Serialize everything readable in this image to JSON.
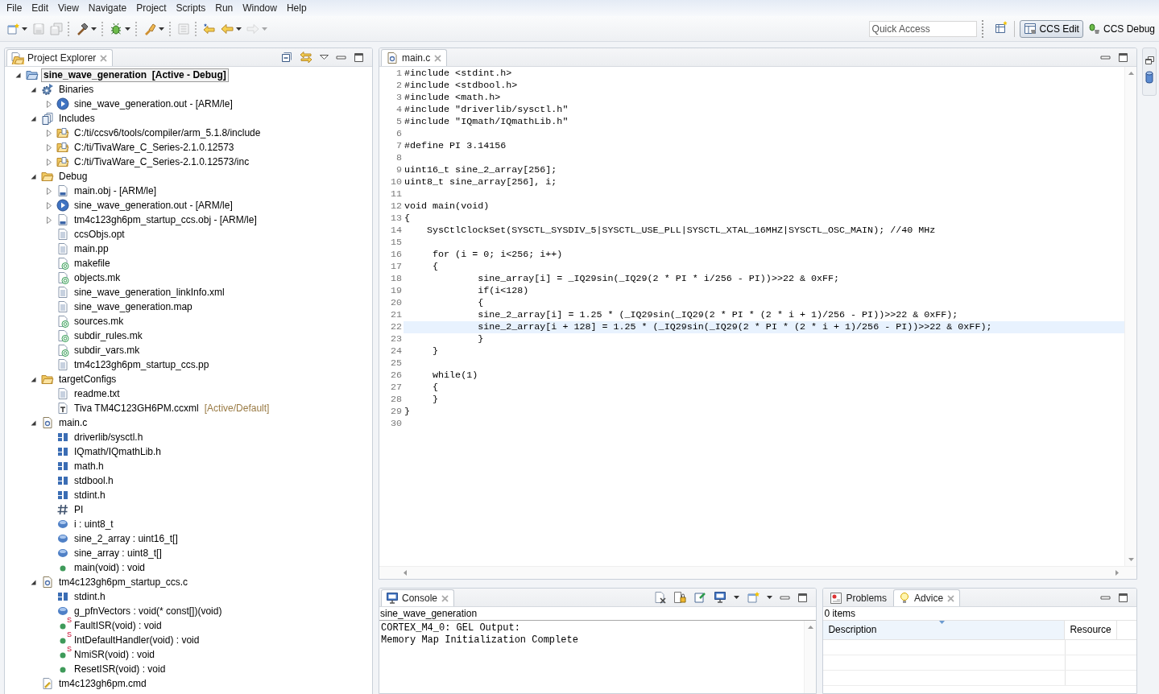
{
  "menu": [
    "File",
    "Edit",
    "View",
    "Navigate",
    "Project",
    "Scripts",
    "Run",
    "Window",
    "Help"
  ],
  "toolbar": {
    "buttons": [
      {
        "kind": "new",
        "disabled": false,
        "dropdown": true
      },
      {
        "kind": "save",
        "disabled": true,
        "dropdown": false
      },
      {
        "kind": "save-all",
        "disabled": true,
        "dropdown": false
      },
      {
        "kind": "separator"
      },
      {
        "kind": "build",
        "disabled": false,
        "dropdown": true
      },
      {
        "kind": "separator"
      },
      {
        "kind": "debug",
        "disabled": false,
        "dropdown": true
      },
      {
        "kind": "separator"
      },
      {
        "kind": "flash",
        "disabled": false,
        "dropdown": true
      },
      {
        "kind": "separator"
      },
      {
        "kind": "terminal",
        "disabled": true,
        "dropdown": false
      },
      {
        "kind": "separator"
      },
      {
        "kind": "last-edit",
        "disabled": false,
        "dropdown": false
      },
      {
        "kind": "back",
        "disabled": false,
        "dropdown": true
      },
      {
        "kind": "forward",
        "disabled": true,
        "dropdown": true
      }
    ],
    "quick_access": {
      "placeholder": "Quick Access"
    },
    "perspectives": [
      {
        "label": "CCS Edit",
        "kind": "edit",
        "selected": true
      },
      {
        "label": "CCS Debug",
        "kind": "debug",
        "selected": false
      }
    ]
  },
  "project_explorer": {
    "tabs": [
      {
        "label": "Project Explorer",
        "selected": true
      }
    ],
    "items": [
      {
        "label": "sine_wave_generation  [Active - Debug]",
        "kind": "project",
        "expanded": true,
        "selected": true,
        "children": [
          {
            "label": "Binaries",
            "kind": "binaries",
            "expanded": true,
            "selected": false,
            "children": [
              {
                "label": "sine_wave_generation.out - [ARM/le]",
                "kind": "executable",
                "expanded": false,
                "selected": false
              }
            ]
          },
          {
            "label": "Includes",
            "kind": "includes",
            "expanded": true,
            "selected": false,
            "children": [
              {
                "label": "C:/ti/ccsv6/tools/compiler/arm_5.1.8/include",
                "kind": "include-path",
                "expanded": false,
                "selected": false
              },
              {
                "label": "C:/ti/TivaWare_C_Series-2.1.0.12573",
                "kind": "include-path",
                "expanded": false,
                "selected": false
              },
              {
                "label": "C:/ti/TivaWare_C_Series-2.1.0.12573/inc",
                "kind": "include-path",
                "expanded": false,
                "selected": false
              }
            ]
          },
          {
            "label": "Debug",
            "kind": "folder",
            "expanded": true,
            "selected": false,
            "children": [
              {
                "label": "main.obj - [ARM/le]",
                "kind": "object",
                "expanded": false,
                "selected": false
              },
              {
                "label": "sine_wave_generation.out - [ARM/le]",
                "kind": "executable",
                "expanded": false,
                "selected": false
              },
              {
                "label": "tm4c123gh6pm_startup_ccs.obj - [ARM/le]",
                "kind": "object",
                "expanded": false,
                "selected": false
              },
              {
                "label": "ccsObjs.opt",
                "kind": "file",
                "selected": false
              },
              {
                "label": "main.pp",
                "kind": "file",
                "selected": false
              },
              {
                "label": "makefile",
                "kind": "makefile",
                "selected": false
              },
              {
                "label": "objects.mk",
                "kind": "makefile",
                "selected": false
              },
              {
                "label": "sine_wave_generation_linkInfo.xml",
                "kind": "file",
                "selected": false
              },
              {
                "label": "sine_wave_generation.map",
                "kind": "file",
                "selected": false
              },
              {
                "label": "sources.mk",
                "kind": "makefile",
                "selected": false
              },
              {
                "label": "subdir_rules.mk",
                "kind": "makefile",
                "selected": false
              },
              {
                "label": "subdir_vars.mk",
                "kind": "makefile",
                "selected": false
              },
              {
                "label": "tm4c123gh6pm_startup_ccs.pp",
                "kind": "file",
                "selected": false
              }
            ]
          },
          {
            "label": "targetConfigs",
            "kind": "folder",
            "expanded": true,
            "selected": false,
            "children": [
              {
                "label": "readme.txt",
                "kind": "file",
                "selected": false
              },
              {
                "label": "Tiva TM4C123GH6PM.ccxml",
                "note": "[Active/Default]",
                "kind": "target-config",
                "selected": false
              }
            ]
          },
          {
            "label": "main.c",
            "kind": "source",
            "expanded": true,
            "selected": false,
            "children": [
              {
                "label": "driverlib/sysctl.h",
                "kind": "include",
                "selected": false
              },
              {
                "label": "IQmath/IQmathLib.h",
                "kind": "include",
                "selected": false
              },
              {
                "label": "math.h",
                "kind": "include",
                "selected": false
              },
              {
                "label": "stdbool.h",
                "kind": "include",
                "selected": false
              },
              {
                "label": "stdint.h",
                "kind": "include",
                "selected": false
              },
              {
                "label": "PI",
                "kind": "macro",
                "selected": false
              },
              {
                "label": "i : uint8_t",
                "kind": "variable",
                "selected": false
              },
              {
                "label": "sine_2_array : uint16_t[]",
                "kind": "variable",
                "selected": false
              },
              {
                "label": "sine_array : uint8_t[]",
                "kind": "variable",
                "selected": false
              },
              {
                "label": "main(void) : void",
                "kind": "function",
                "selected": false
              }
            ]
          },
          {
            "label": "tm4c123gh6pm_startup_ccs.c",
            "kind": "source",
            "expanded": true,
            "selected": false,
            "children": [
              {
                "label": "stdint.h",
                "kind": "include",
                "selected": false
              },
              {
                "label": "g_pfnVectors : void(* const[])(void)",
                "kind": "variable",
                "selected": false
              },
              {
                "label": "FaultISR(void) : void",
                "kind": "function",
                "badge": "S",
                "selected": false
              },
              {
                "label": "IntDefaultHandler(void) : void",
                "kind": "function",
                "badge": "S",
                "selected": false
              },
              {
                "label": "NmiSR(void) : void",
                "kind": "function",
                "badge": "S",
                "selected": false
              },
              {
                "label": "ResetISR(void) : void",
                "kind": "function",
                "selected": false
              }
            ]
          },
          {
            "label": "tm4c123gh6pm.cmd",
            "kind": "linker-command",
            "selected": false
          }
        ]
      }
    ]
  },
  "editor": {
    "tabs": [
      {
        "label": "main.c",
        "selected": true
      }
    ],
    "lines": [
      {
        "number": "1",
        "text": "#include <stdint.h>",
        "current": false
      },
      {
        "number": "2",
        "text": "#include <stdbool.h>",
        "current": false
      },
      {
        "number": "3",
        "text": "#include <math.h>",
        "current": false
      },
      {
        "number": "4",
        "text": "#include \"driverlib/sysctl.h\"",
        "current": false
      },
      {
        "number": "5",
        "text": "#include \"IQmath/IQmathLib.h\"",
        "current": false
      },
      {
        "number": "6",
        "current": false
      },
      {
        "number": "7",
        "text": "#define PI 3.14156",
        "current": false
      },
      {
        "number": "8",
        "current": false
      },
      {
        "number": "9",
        "text": "uint16_t sine_2_array[256];",
        "current": false
      },
      {
        "number": "10",
        "text": "uint8_t sine_array[256], i;",
        "current": false
      },
      {
        "number": "11",
        "current": false
      },
      {
        "number": "12",
        "text": "void main(void)",
        "current": false
      },
      {
        "number": "13",
        "text": "{",
        "current": false
      },
      {
        "number": "14",
        "text": "    SysCtlClockSet(SYSCTL_SYSDIV_5|SYSCTL_USE_PLL|SYSCTL_XTAL_16MHZ|SYSCTL_OSC_MAIN); //40 MHz",
        "current": false
      },
      {
        "number": "15",
        "current": false
      },
      {
        "number": "16",
        "text": "     for (i = 0; i<256; i++)",
        "current": false
      },
      {
        "number": "17",
        "text": "     {",
        "current": false
      },
      {
        "number": "18",
        "text": "             sine_array[i] = _IQ29sin(_IQ29(2 * PI * i/256 - PI))>>22 & 0xFF;",
        "current": false
      },
      {
        "number": "19",
        "text": "             if(i<128)",
        "current": false
      },
      {
        "number": "20",
        "text": "             {",
        "current": false
      },
      {
        "number": "21",
        "text": "             sine_2_array[i] = 1.25 * (_IQ29sin(_IQ29(2 * PI * (2 * i + 1)/256 - PI))>>22 & 0xFF);",
        "current": false
      },
      {
        "number": "22",
        "text": "             sine_2_array[i + 128] = 1.25 * (_IQ29sin(_IQ29(2 * PI * (2 * i + 1)/256 - PI))>>22 & 0xFF);",
        "current": true
      },
      {
        "number": "23",
        "text": "             }",
        "current": false
      },
      {
        "number": "24",
        "text": "     }",
        "current": false
      },
      {
        "number": "25",
        "current": false
      },
      {
        "number": "26",
        "text": "     while(1)",
        "current": false
      },
      {
        "number": "27",
        "text": "     {",
        "current": false
      },
      {
        "number": "28",
        "text": "     }",
        "current": false
      },
      {
        "number": "29",
        "text": "}",
        "current": false
      },
      {
        "number": "30",
        "current": false
      }
    ]
  },
  "console": {
    "tabs": [
      {
        "label": "Console",
        "selected": true
      }
    ],
    "name": "sine_wave_generation",
    "output": [
      "CORTEX_M4_0: GEL Output:",
      "Memory Map Initialization Complete"
    ]
  },
  "problems": {
    "tabs": [
      {
        "label": "Problems",
        "kind": "problems",
        "selected": false
      },
      {
        "label": "Advice",
        "kind": "advice",
        "selected": true
      }
    ],
    "summary": "0 items",
    "columns": [
      "Description",
      "Resource"
    ]
  }
}
